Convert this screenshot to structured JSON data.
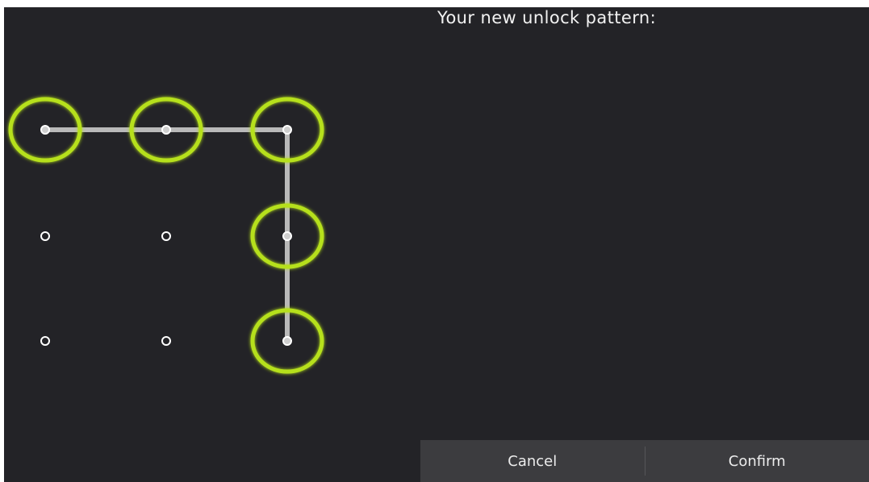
{
  "header": {
    "title": "Your new unlock pattern:"
  },
  "pattern": {
    "grid_size": 3,
    "selected_sequence": [
      1,
      2,
      3,
      6,
      9
    ],
    "colors": {
      "ring": "#b6e01c",
      "line": "#b9b9b9",
      "dot_idle": "#ffffff",
      "dot_active": "#cfcfcf"
    }
  },
  "actions": {
    "cancel_label": "Cancel",
    "confirm_label": "Confirm"
  }
}
